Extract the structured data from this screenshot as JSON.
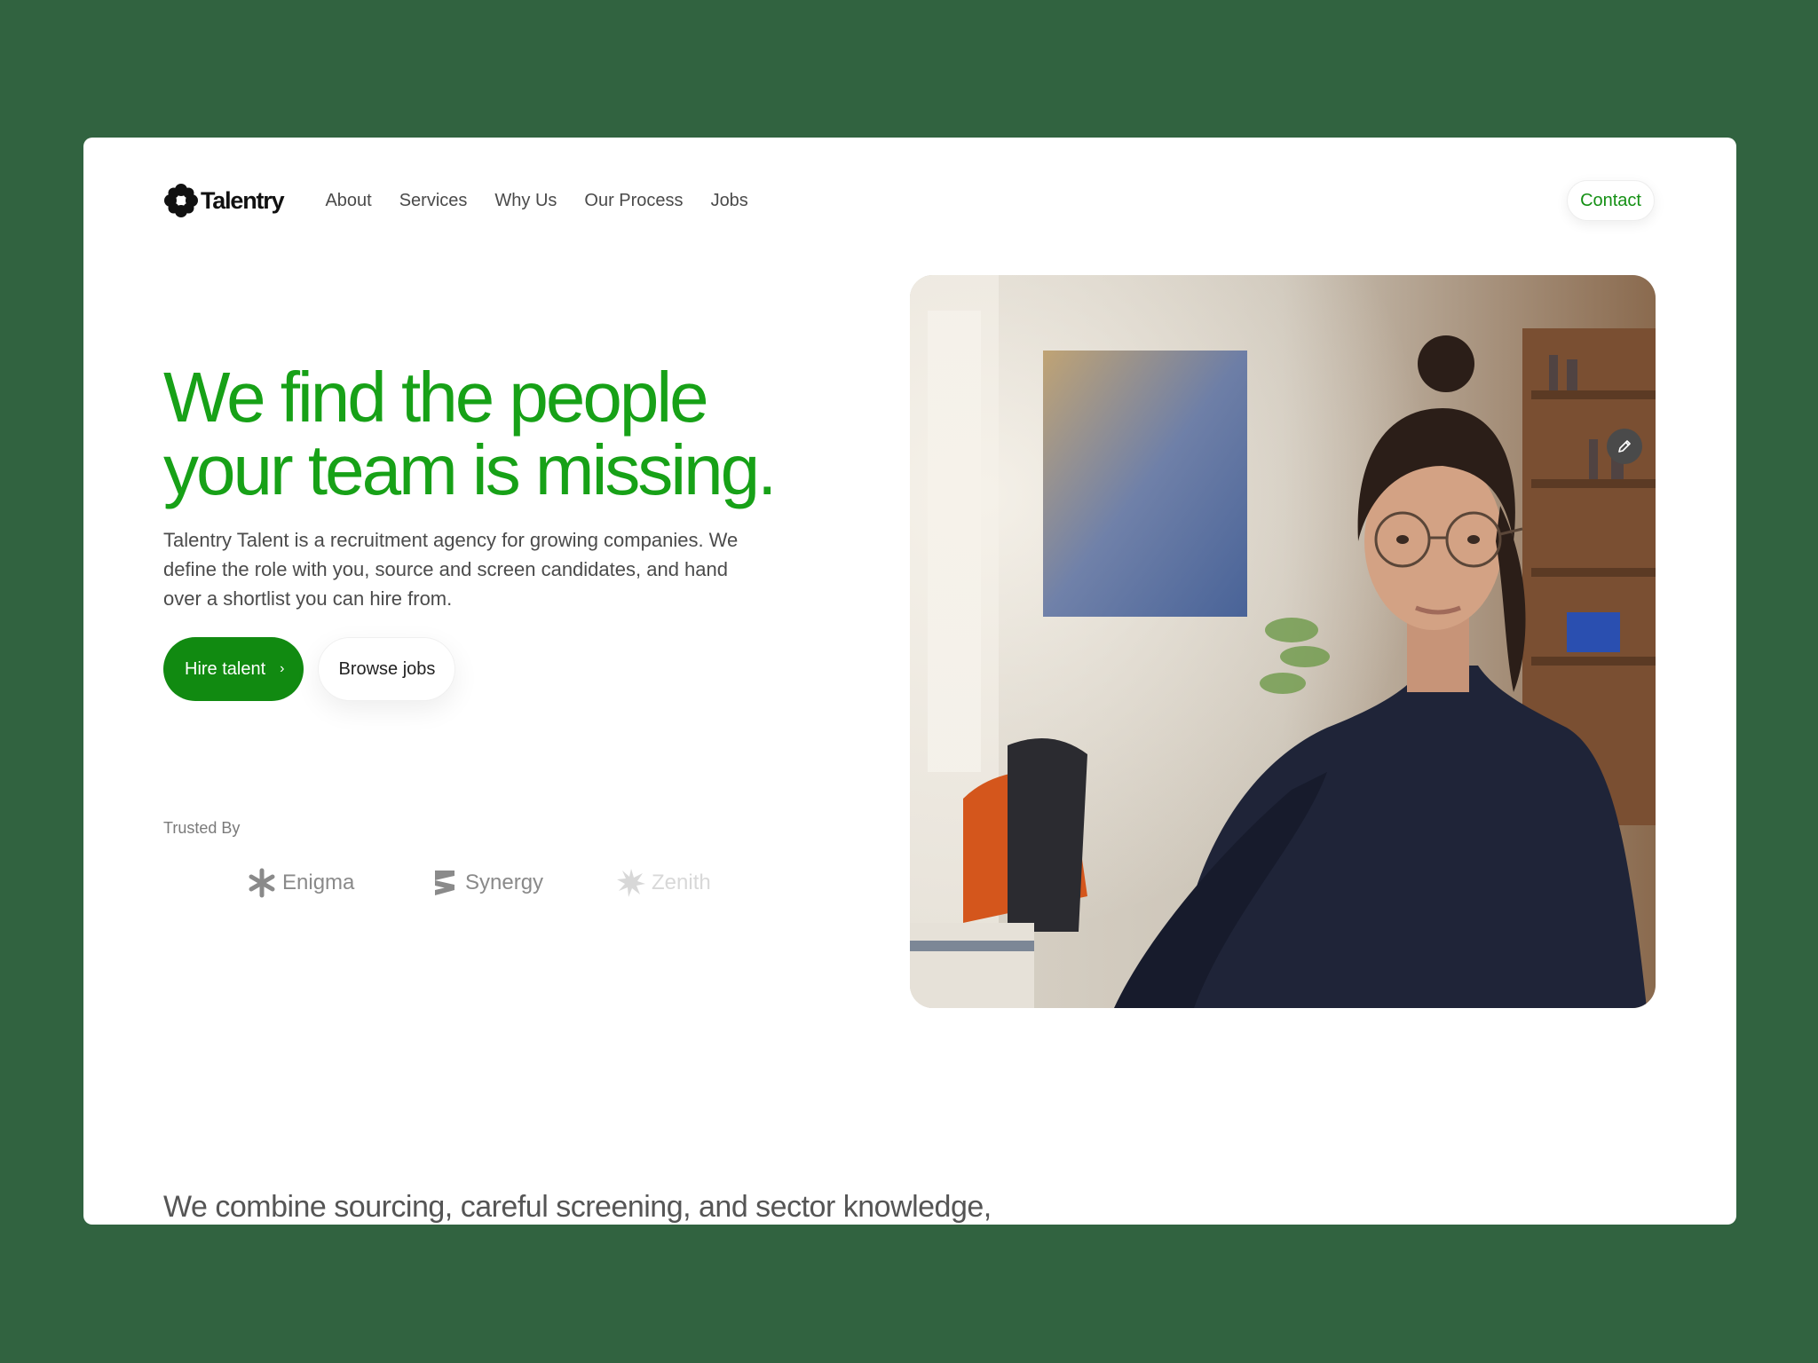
{
  "brand": {
    "name": "Talentry",
    "accent": "#17a117",
    "accent_dark": "#118a11",
    "page_bg": "#316340"
  },
  "nav": {
    "links": [
      "About",
      "Services",
      "Why Us",
      "Our Process",
      "Jobs"
    ],
    "contact_label": "Contact"
  },
  "hero": {
    "title_line1": "We find the people",
    "title_line2": "your team is missing.",
    "description": "Talentry Talent is a recruitment agency for growing companies. We define the role with you, source and screen candidates, and hand over a shortlist you can hire from.",
    "primary_cta": "Hire talent",
    "primary_cta_icon": "chevron-right-icon",
    "secondary_cta": "Browse jobs"
  },
  "trusted": {
    "label": "Trusted By",
    "logos": [
      {
        "name": "Enigma",
        "icon": "asterisk-icon"
      },
      {
        "name": "Synergy",
        "icon": "s-stripes-icon"
      },
      {
        "name": "Zenith",
        "icon": "starburst-icon"
      }
    ]
  },
  "photo": {
    "icon": "portrait-photo"
  },
  "edit_button": {
    "icon": "pencil-icon"
  },
  "section": {
    "lead": "We combine sourcing, careful screening, and sector knowledge,"
  }
}
